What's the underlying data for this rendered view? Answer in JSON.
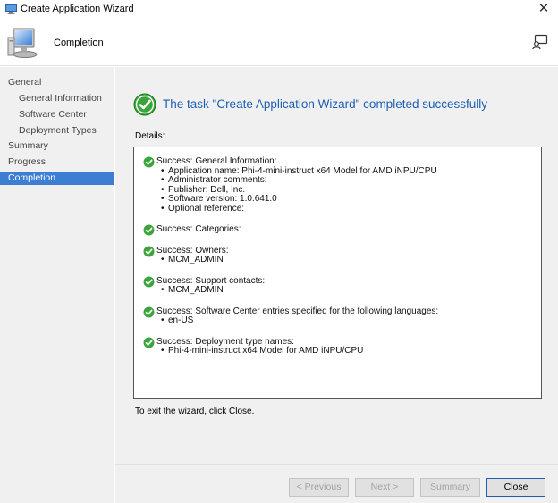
{
  "window": {
    "title": "Create Application Wizard"
  },
  "header": {
    "page_title": "Completion"
  },
  "sidebar": {
    "items": [
      {
        "label": "General",
        "level": "top",
        "active": false
      },
      {
        "label": "General Information",
        "level": "sub",
        "active": false
      },
      {
        "label": "Software Center",
        "level": "sub",
        "active": false
      },
      {
        "label": "Deployment Types",
        "level": "sub",
        "active": false
      },
      {
        "label": "Summary",
        "level": "top",
        "active": false
      },
      {
        "label": "Progress",
        "level": "top",
        "active": false
      },
      {
        "label": "Completion",
        "level": "top",
        "active": true
      }
    ]
  },
  "main": {
    "status_message": "The task \"Create Application Wizard\" completed successfully",
    "details_label": "Details:",
    "details": [
      {
        "heading": "Success: General Information:",
        "bullets": [
          "Application name: Phi-4-mini-instruct x64 Model for AMD iNPU/CPU",
          "Administrator comments:",
          "Publisher: Dell, Inc.",
          "Software version: 1.0.641.0",
          "Optional reference:"
        ]
      },
      {
        "heading": "Success: Categories:",
        "bullets": []
      },
      {
        "heading": "Success: Owners:",
        "bullets": [
          "MCM_ADMIN"
        ]
      },
      {
        "heading": "Success: Support contacts:",
        "bullets": [
          "MCM_ADMIN"
        ]
      },
      {
        "heading": "Success: Software Center entries specified for the following languages:",
        "bullets": [
          "en-US"
        ]
      },
      {
        "heading": "Success: Deployment type names:",
        "bullets": [
          "Phi-4-mini-instruct x64 Model for AMD iNPU/CPU"
        ]
      }
    ],
    "exit_hint": "To exit the wizard, click Close."
  },
  "footer": {
    "previous_label": "< Previous",
    "next_label": "Next >",
    "summary_label": "Summary",
    "close_label": "Close"
  },
  "colors": {
    "accent": "#3c7ed4",
    "status_text": "#1c5fb5",
    "success_green": "#3aa53a"
  },
  "icons": {
    "app": "computer-wizard-icon",
    "feedback": "feedback-icon",
    "status": "success-check-icon",
    "close": "close-icon"
  }
}
